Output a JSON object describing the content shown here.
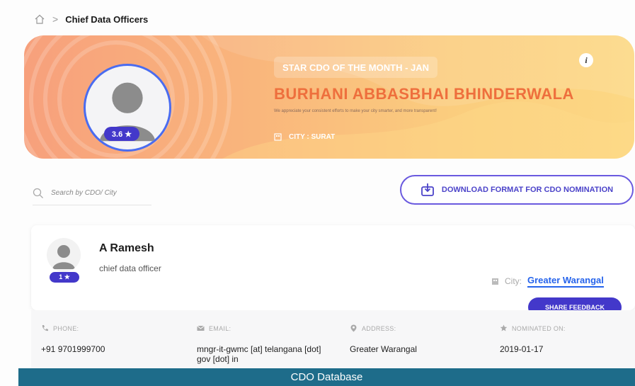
{
  "breadcrumb": {
    "current": "Chief Data Officers"
  },
  "banner": {
    "title": "STAR CDO OF THE MONTH - JAN",
    "name": "BURHANI ABBASBHAI BHINDERWALA",
    "appreciation": "We appreciate your consistent efforts to make your city smarter, and more transparent!",
    "city": "CITY : SURAT",
    "rating": "3.6 ★",
    "info_icon": "i"
  },
  "search": {
    "placeholder": "Search by CDO/ City"
  },
  "download": {
    "label": "DOWNLOAD FORMAT FOR CDO NOMINATION"
  },
  "card": {
    "name": "A Ramesh",
    "role": "chief data officer",
    "rating": "1 ★",
    "city_label": "City:",
    "city_value": "Greater Warangal",
    "share_label": "SHARE FEEDBACK",
    "phone_label": "PHONE:",
    "phone_value": "+91 9701999700",
    "email_label": "EMAIL:",
    "email_value": "mngr-it-gwmc [at] telangana [dot] gov [dot] in",
    "address_label": "ADDRESS:",
    "address_value": "Greater Warangal",
    "nominated_label": "NOMINATED ON:",
    "nominated_value": "2019-01-17"
  },
  "footer": {
    "caption": "CDO Database"
  },
  "colors": {
    "accent": "#4338ca",
    "banner_name": "#ee6f3d",
    "footer": "#1e6c8a",
    "link": "#2563eb"
  }
}
